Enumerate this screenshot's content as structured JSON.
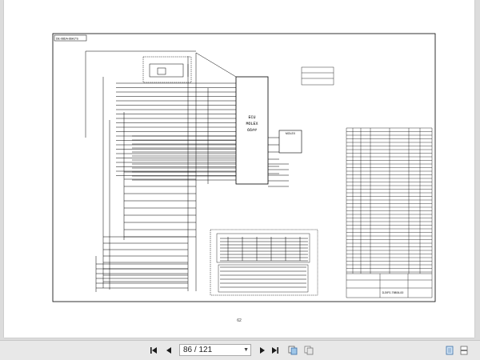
{
  "document": {
    "title_block_label": "DE-08DA-66A1*S",
    "ecu_label_lines": [
      "ECU",
      "MOLEX",
      "66##"
    ],
    "connector_label": "MOLEX",
    "drawing_footer": "DJXF0-79806-00",
    "page_footer_number": "62"
  },
  "toolbar": {
    "page_current": "86",
    "page_total": "121",
    "page_display": "86 / 121"
  },
  "icons": {
    "first": "skip-first-icon",
    "prev": "prev-page-icon",
    "next": "next-page-icon",
    "last": "skip-last-icon",
    "single": "single-page-view-icon",
    "continuous": "continuous-page-view-icon",
    "fit": "fit-page-icon",
    "side": "side-by-side-icon"
  }
}
